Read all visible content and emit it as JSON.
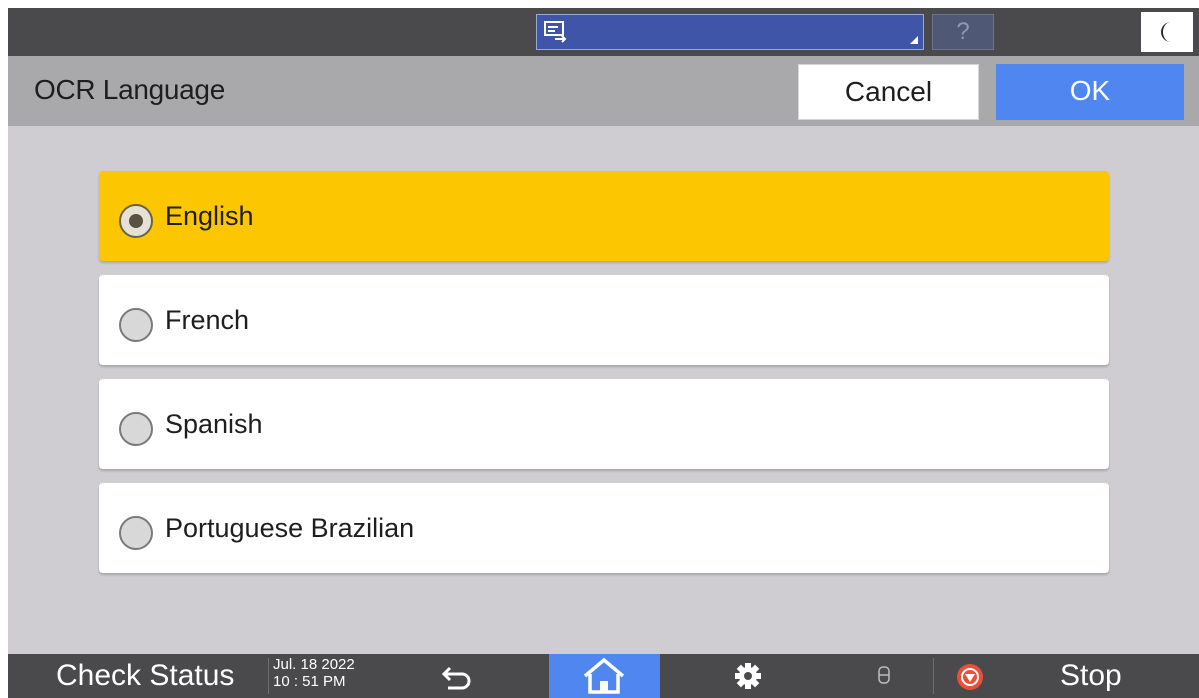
{
  "system_bar": {
    "app_switch_icon": "screen-switch-icon",
    "help_label": "?",
    "energy_icon": "moon-icon"
  },
  "header": {
    "title": "OCR Language",
    "cancel_label": "Cancel",
    "ok_label": "OK"
  },
  "options": [
    {
      "label": "English",
      "selected": true
    },
    {
      "label": "French",
      "selected": false
    },
    {
      "label": "Spanish",
      "selected": false
    },
    {
      "label": "Portuguese Brazilian",
      "selected": false
    }
  ],
  "bottom_bar": {
    "check_status_label": "Check Status",
    "date": "Jul. 18 2022",
    "time": "10 : 51 PM",
    "back_icon": "back-arrow-icon",
    "home_icon": "home-icon",
    "settings_icon": "gear-icon",
    "data_icon": "data-indicator-icon",
    "stop_icon": "stop-icon",
    "stop_label": "Stop"
  },
  "colors": {
    "selected_option": "#fcc700",
    "ok_button": "#4f86f0",
    "home_button": "#4f86f0",
    "stop_icon": "#e8503a"
  }
}
